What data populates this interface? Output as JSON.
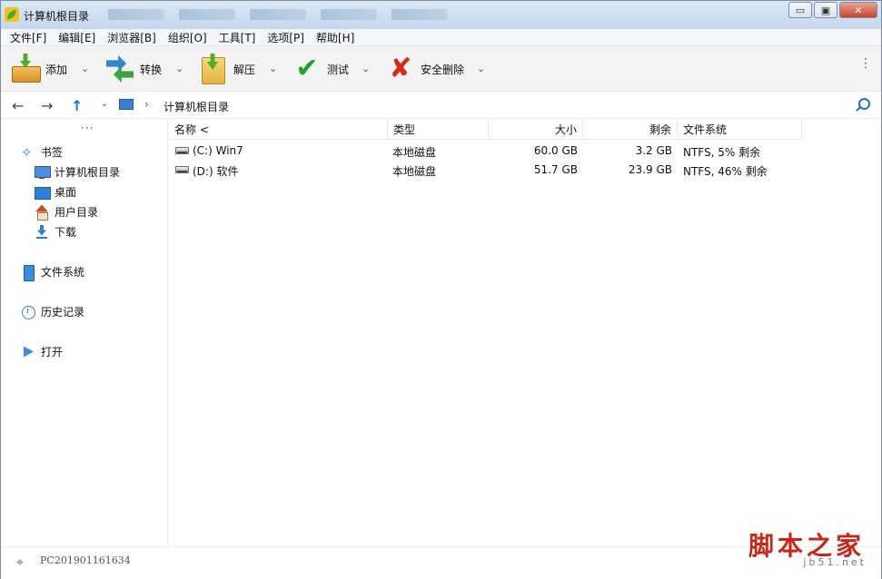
{
  "window": {
    "title": "计算机根目录",
    "caption": {
      "minimize": "▭",
      "maximize": "▣",
      "close": "✕"
    }
  },
  "menu": [
    "文件[F]",
    "编辑[E]",
    "浏览器[B]",
    "组织[O]",
    "工具[T]",
    "选项[P]",
    "帮助[H]"
  ],
  "toolbar": {
    "add": "添加",
    "convert": "转换",
    "extract": "解压",
    "test": "测试",
    "delete": "安全删除",
    "dropdown_glyph": "⌄",
    "more_glyph": "⋮"
  },
  "address": {
    "back": "←",
    "forward": "→",
    "up": "↑",
    "down_glyph": "⌄",
    "separator": "›",
    "path": "计算机根目录"
  },
  "sidebar": {
    "dots": "···",
    "bookmarks": "书签",
    "bookmark_items": [
      "计算机根目录",
      "桌面",
      "用户目录",
      "下载"
    ],
    "filesystem": "文件系统",
    "history": "历史记录",
    "open": "打开"
  },
  "columns": {
    "name": "名称 <",
    "type": "类型",
    "size": "大小",
    "free": "剩余",
    "fs": "文件系统"
  },
  "rows": [
    {
      "name": "(C:) Win7",
      "type": "本地磁盘",
      "size": "60.0 GB",
      "free": "3.2 GB",
      "fs": "NTFS, 5% 剩余"
    },
    {
      "name": "(D:) 软件",
      "type": "本地磁盘",
      "size": "51.7 GB",
      "free": "23.9 GB",
      "fs": "NTFS, 46% 剩余"
    }
  ],
  "status": {
    "icon_glyph": "⌖",
    "computer": "PC201901161634"
  },
  "watermark": {
    "main": "脚本之家",
    "sub": "jb51.net"
  }
}
